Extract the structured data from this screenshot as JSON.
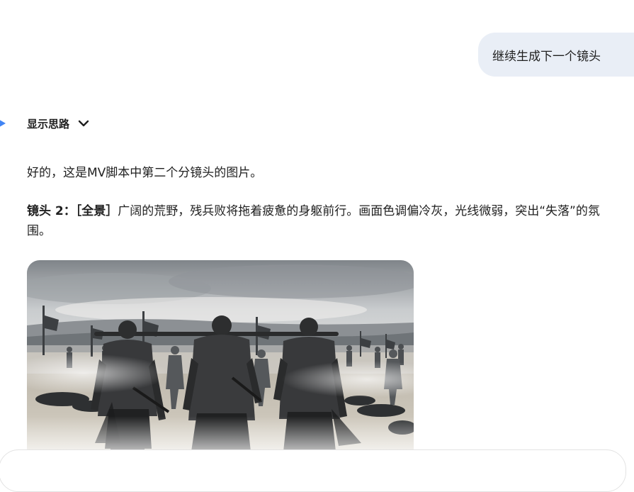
{
  "user_message": "继续生成下一个镜头",
  "thoughts_toggle": {
    "label": "显示思路"
  },
  "response": {
    "intro": "好的，这是MV脚本中第二个分镜头的图片。",
    "shot_label": "镜头 2：［全景］",
    "shot_text": "广阔的荒野，残兵败将拖着疲惫的身躯前行。画面色调偏冷灰，光线微弱，突出“失落”的氛围。"
  },
  "colors": {
    "bubble": "#e9eef6",
    "spark": "#4285f4",
    "text": "#1f1f1f"
  },
  "icons": {
    "spark": "gemini-spark-icon",
    "chevron": "chevron-down-icon"
  }
}
